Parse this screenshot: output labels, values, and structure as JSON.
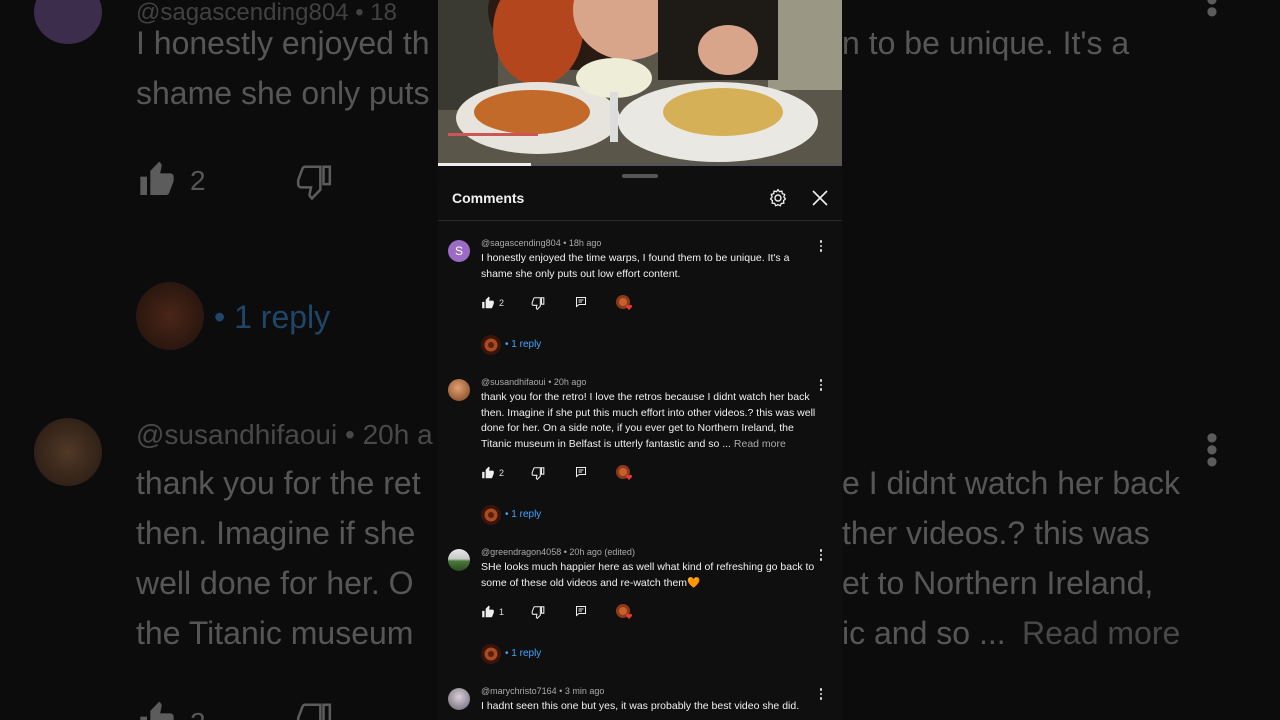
{
  "panel": {
    "title": "Comments"
  },
  "comments": [
    {
      "avatar_letter": "S",
      "author": "@sagascending804",
      "time": "18h ago",
      "edited": "",
      "text": "I honestly enjoyed the time warps, I found them to be unique. It's a shame she only puts out low effort content.",
      "read_more": "",
      "likes": "2",
      "replies": "• 1 reply"
    },
    {
      "avatar_letter": "",
      "author": "@susandhifaoui",
      "time": "20h ago",
      "edited": "",
      "text": "thank you for the retro!  I love the retros because I didnt watch her back then. Imagine if she put this much effort into other videos.?  this was well done for her.  On a side note, if you ever get to Northern Ireland, the Titanic museum in Belfast is utterly fantastic and so ...",
      "read_more": "Read more",
      "likes": "2",
      "replies": "• 1 reply"
    },
    {
      "avatar_letter": "",
      "author": "@greendragon4058",
      "time": "20h ago",
      "edited": "(edited)",
      "text": "SHe looks much happier here as well what kind of refreshing go back to some of these old videos and re-watch them🧡",
      "read_more": "",
      "likes": "1",
      "replies": "• 1 reply"
    },
    {
      "avatar_letter": "",
      "author": "@marychristo7164",
      "time": "3 min ago",
      "edited": "",
      "text": "I hadnt seen this one but yes, it was probably the best video she did.",
      "read_more": "",
      "likes": "",
      "replies": ""
    }
  ],
  "background": {
    "line1": "I honestly enjoyed th",
    "line1b": "n to be unique. It's a",
    "line2": "shame she only puts",
    "likes": "2",
    "reply": "• 1 reply",
    "author": "@susandhifaoui • 20h a",
    "t1a": "thank you for the ret",
    "t1b": "e I didnt watch her back",
    "t2a": "then. Imagine if she",
    "t2b": "ther videos.?  this was",
    "t3a": "well done for her.  O",
    "t3b": "et to Northern Ireland,",
    "t4a": "the Titanic museum",
    "t4b": "ic and so ...",
    "t4c": "Read more",
    "likes2": "2"
  },
  "colors": {
    "link": "#3ea6ff",
    "avatar_s": "#9c6bc6",
    "heart": "#e53935"
  },
  "icons": [
    "thumbs-up-icon",
    "thumbs-down-icon",
    "reply-icon",
    "creator-heart-icon",
    "settings-icon",
    "close-icon",
    "more-vert-icon"
  ]
}
